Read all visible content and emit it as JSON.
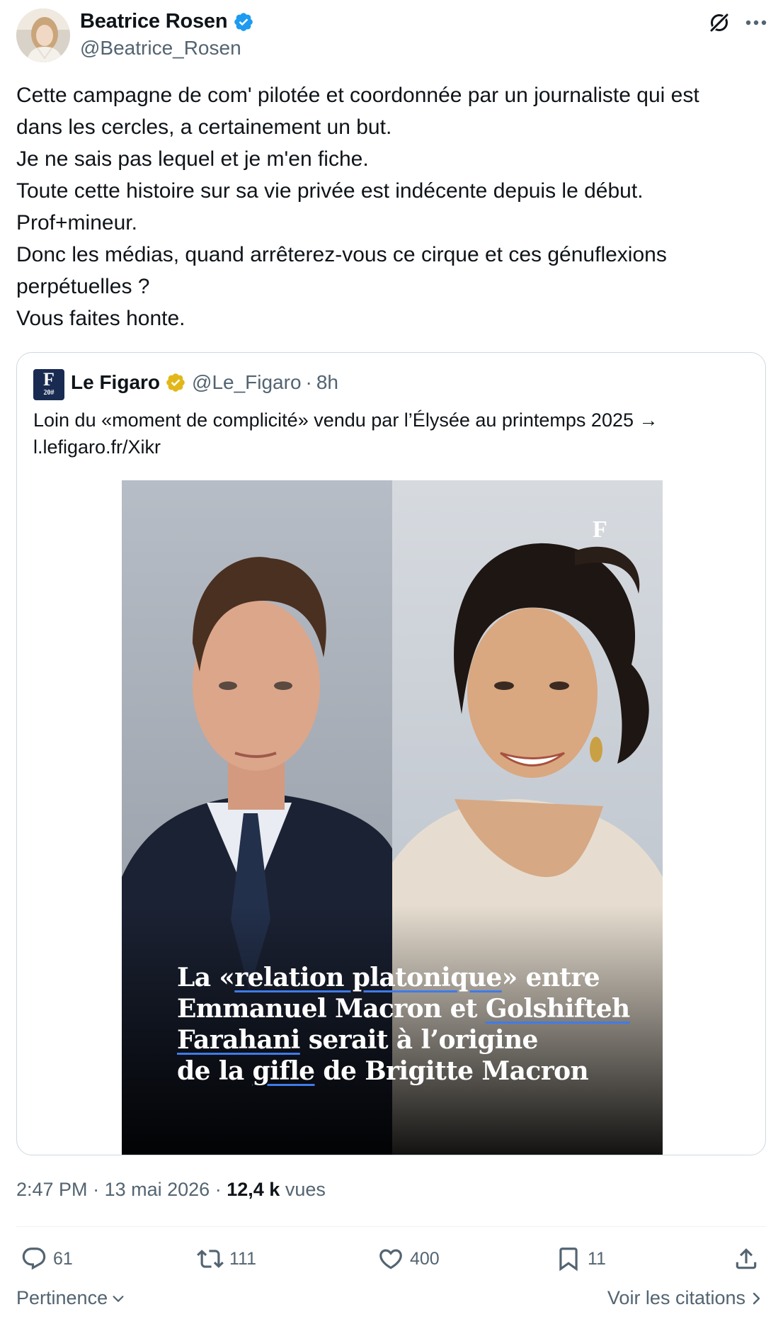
{
  "author": {
    "name": "Beatrice Rosen",
    "handle": "@Beatrice_Rosen",
    "verified_color": "#1d9bf0"
  },
  "header_icons": [
    "grok-icon",
    "more-icon"
  ],
  "tweet": {
    "lines": [
      "Cette campagne de com' pilotée et coordonnée par un journaliste qui est",
      "dans les cercles, a certainement un but.",
      "Je ne sais pas lequel et je m'en fiche.",
      "Toute cette histoire sur sa vie privée est indécente depuis le début.",
      "Prof+mineur.",
      "Donc les médias, quand arrêterez-vous ce cirque et ces génuflexions",
      "perpétuelles ?",
      "Vous faites honte."
    ]
  },
  "quoted": {
    "logo_letter": "F",
    "logo_year": "20#",
    "name": "Le Figaro",
    "handle": "@Le_Figaro",
    "separator": "·",
    "time": "8h",
    "gold_badge_color": "#e2b719",
    "text_lines": [
      "Loin du «moment de complicité» vendu par l’Élysée au printemps 2025 →",
      "l.lefigaro.fr/Xikr"
    ],
    "image": {
      "watermark": "F",
      "headline_parts": {
        "l1_a": "La «",
        "l1_b": "relation platonique",
        "l1_c": "» entre",
        "l2_a": "Emmanuel Macron et ",
        "l2_b": "Golshifteh",
        "l3_a": "Farahani",
        "l3_b": " serait à l’origine",
        "l4_a": "de la ",
        "l4_b": "gifle",
        "l4_c": " de Brigitte Macron"
      }
    }
  },
  "meta": {
    "time": "2:47 PM",
    "sep1": "·",
    "date": "13 mai 2026",
    "sep2": "·",
    "views_count": "12,4 k",
    "views_label": "vues"
  },
  "actions": {
    "replies": "61",
    "reposts": "111",
    "likes": "400",
    "bookmarks": "11"
  },
  "footer": {
    "sort_label": "Pertinence",
    "quotes_label": "Voir les citations"
  }
}
